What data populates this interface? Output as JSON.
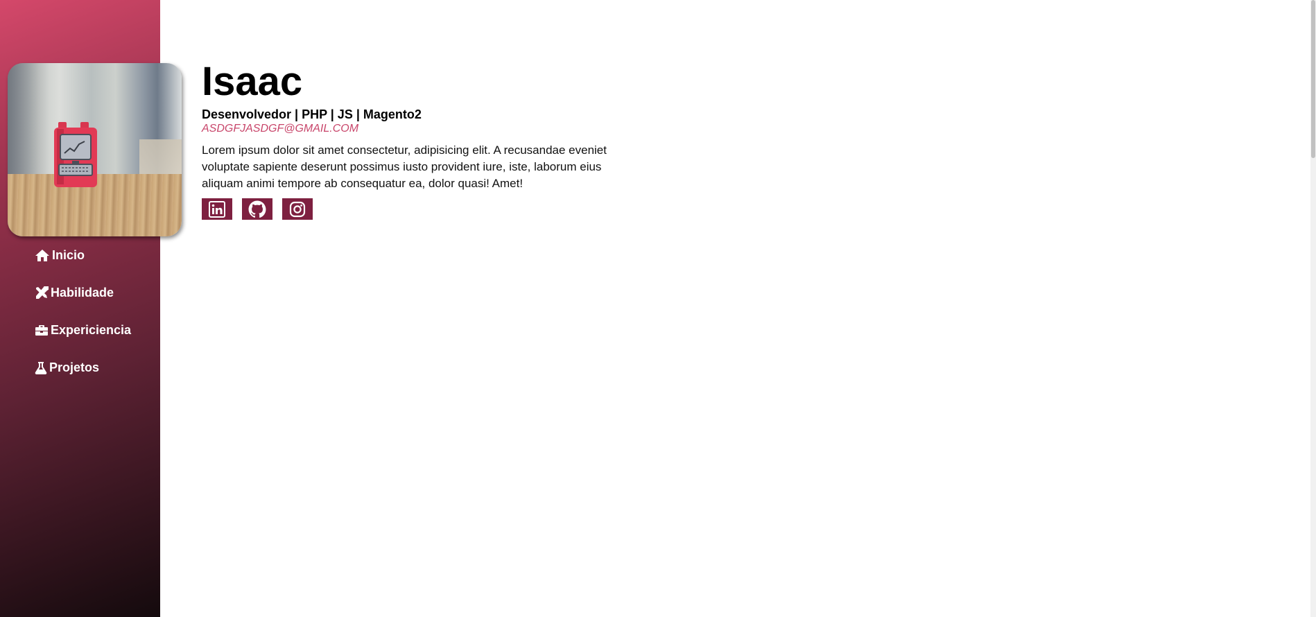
{
  "profile": {
    "name": "Isaac",
    "subtitle": "Desenvolvedor | PHP | JS | Magento2",
    "email": "asdgfjasdgf@gmail.com",
    "bio": "Lorem ipsum dolor sit amet consectetur, adipisicing elit. A recusandae eveniet voluptate sapiente deserunt possimus iusto provident iure, iste, laborum eius aliquam animi tempore ab consequatur ea, dolor quasi! Amet!"
  },
  "nav": {
    "items": [
      {
        "label": "Inicio",
        "icon": "home-icon"
      },
      {
        "label": "Habilidade",
        "icon": "tools-icon"
      },
      {
        "label": "Expericiencia",
        "icon": "briefcase-icon"
      },
      {
        "label": "Projetos",
        "icon": "flask-icon"
      }
    ]
  },
  "social": [
    {
      "icon": "linkedin-icon"
    },
    {
      "icon": "github-icon"
    },
    {
      "icon": "instagram-icon"
    }
  ],
  "colors": {
    "accent": "#c8456a",
    "social_bg": "#7e2040",
    "sidebar_top": "#d4486a",
    "sidebar_bottom": "#140a0d"
  }
}
